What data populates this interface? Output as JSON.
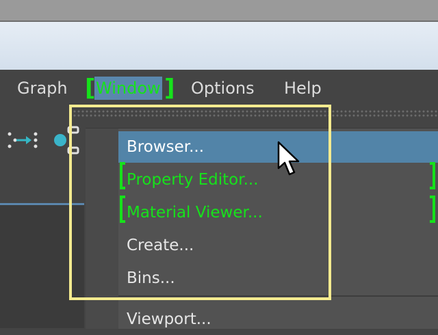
{
  "menubar": {
    "items": [
      {
        "label": "Graph"
      },
      {
        "label": "Window",
        "active": true
      },
      {
        "label": "Options"
      },
      {
        "label": "Help"
      }
    ]
  },
  "window_menu": {
    "items": [
      {
        "label": "Browser...",
        "state": "hovered"
      },
      {
        "label": "Property Editor...",
        "annotated": true
      },
      {
        "label": "Material Viewer...",
        "annotated": true
      },
      {
        "label": "Create..."
      },
      {
        "label": "Bins..."
      },
      {
        "label": "Viewport..."
      }
    ]
  },
  "toolbar": {
    "icons": [
      "graph-input-connections-icon",
      "node-layout-icon"
    ]
  },
  "colors": {
    "menu_bg": "#525252",
    "hover_bg": "#5284a8",
    "annotation_green": "#16e21b",
    "highlight_yellow": "#f5eb8f"
  }
}
